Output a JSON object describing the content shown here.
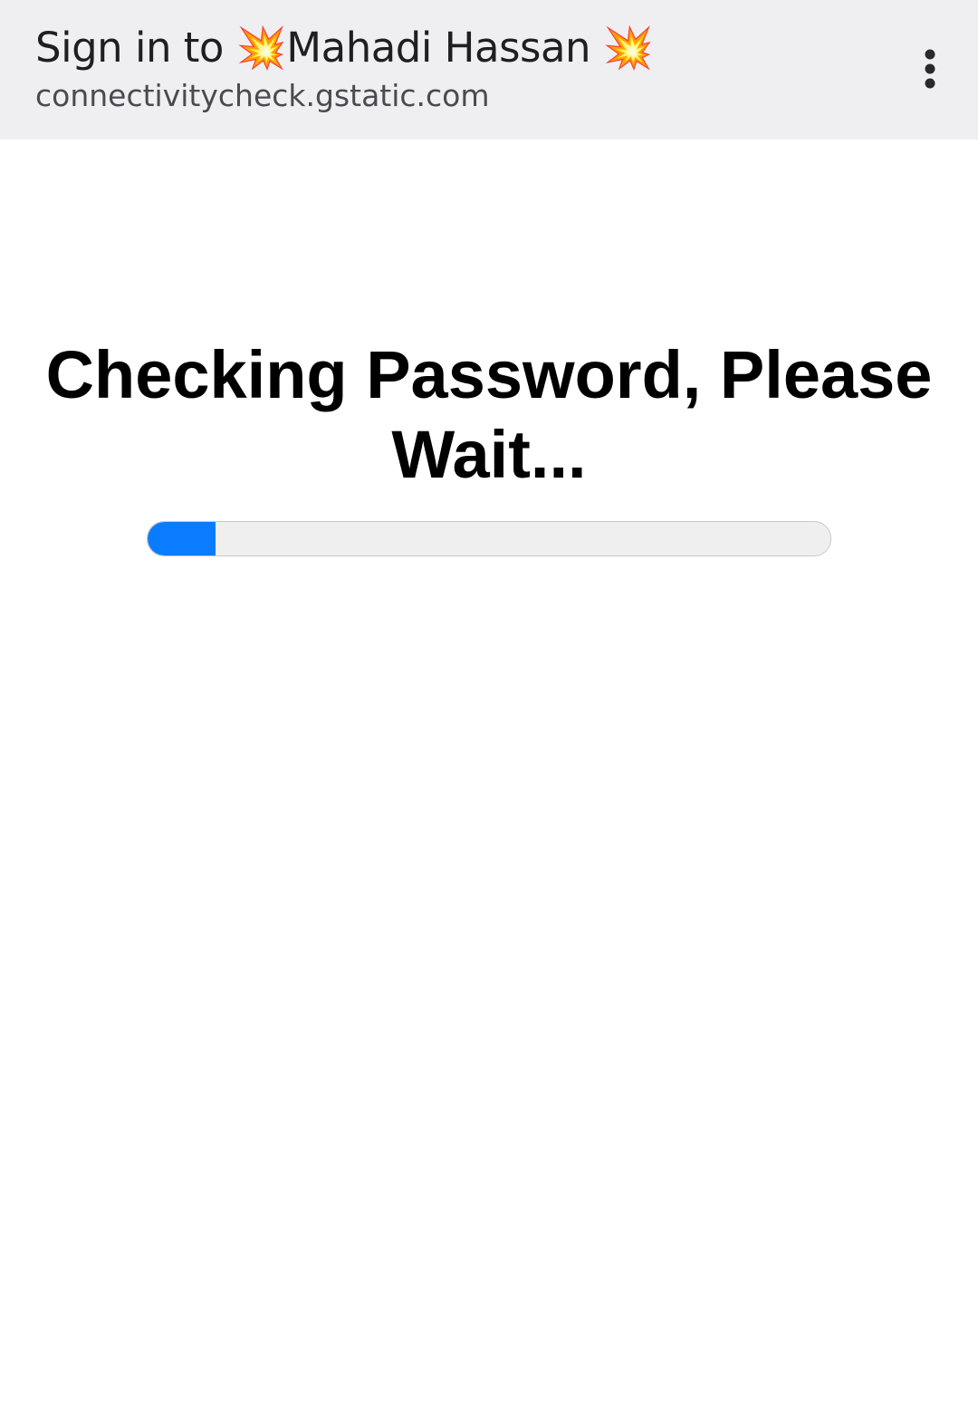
{
  "header": {
    "title": "Sign in to 💥Mahadi Hassan 💥",
    "url": "connectivitycheck.gstatic.com",
    "menu_icon": "more-vert-icon"
  },
  "main": {
    "heading": "Checking Password, Please Wait...",
    "progress": {
      "value_percent": 10,
      "fill_color": "#0a7cff",
      "track_color": "#efefef"
    }
  },
  "colors": {
    "header_bg": "#efeff2",
    "accent": "#0a7cff"
  }
}
